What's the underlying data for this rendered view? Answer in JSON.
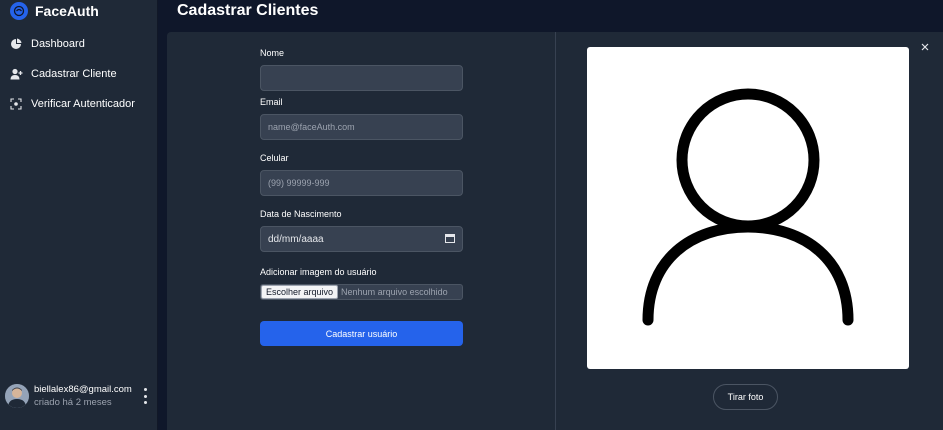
{
  "app": {
    "name": "FaceAuth",
    "accent": "#2563eb"
  },
  "sidebar": {
    "items": [
      {
        "label": "Dashboard",
        "icon": "pie-chart-icon"
      },
      {
        "label": "Cadastrar Cliente",
        "icon": "add-user-icon"
      },
      {
        "label": "Verificar Autenticador",
        "icon": "face-scan-icon"
      }
    ],
    "user": {
      "email": "biellalex86@gmail.com",
      "created": "criado há 2 meses"
    }
  },
  "page": {
    "title": "Cadastrar Clientes"
  },
  "form": {
    "name_label": "Nome",
    "name_value": "",
    "email_label": "Email",
    "email_placeholder": "name@faceAuth.com",
    "phone_label": "Celular",
    "phone_placeholder": "(99) 99999-999",
    "birth_label": "Data de Nascimento",
    "birth_value": "dd/mm/aaaa",
    "image_label": "Adicionar imagem do usuário",
    "file_button": "Escolher arquivo",
    "file_status": "Nenhum arquivo escolhido",
    "submit_label": "Cadastrar usuário"
  },
  "camera": {
    "take_photo_label": "Tirar foto",
    "placeholder_icon": "user-silhouette-icon"
  }
}
